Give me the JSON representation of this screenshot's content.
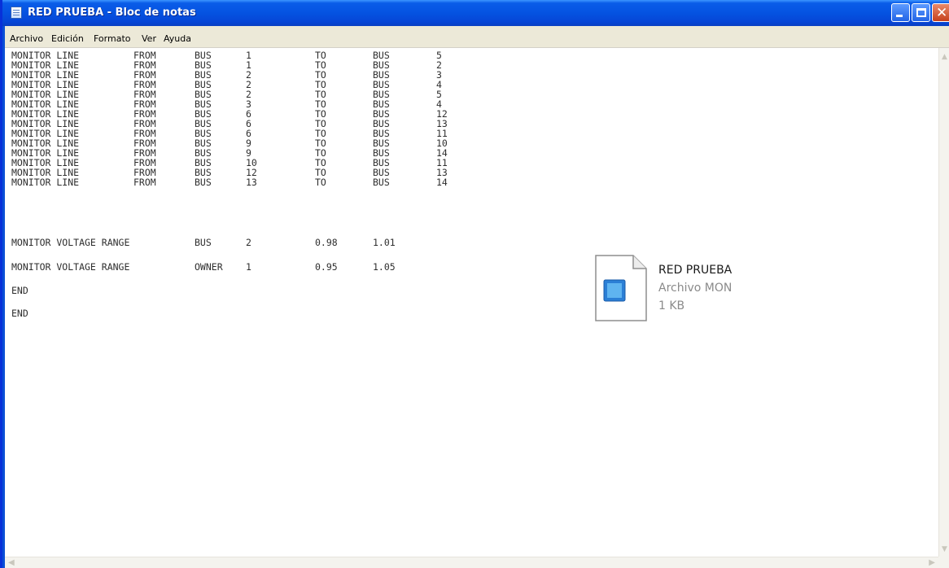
{
  "window": {
    "title": "RED PRUEBA - Bloc de notas",
    "icon": "notepad-icon",
    "controls": {
      "minimize": "minimize-icon",
      "maximize": "maximize-icon",
      "close": "close-icon",
      "close_glyph": "✕"
    }
  },
  "menu": [
    "Archivo",
    "Edición",
    "Formato",
    "Ver",
    "Ayuda"
  ],
  "content": {
    "columns": [
      "MONITOR LINE",
      "FROM",
      "BUS",
      "from_bus",
      "TO",
      "BUS",
      "to_bus"
    ],
    "lines": [
      [
        "MONITOR LINE",
        "FROM",
        "BUS",
        "1",
        "TO",
        "BUS",
        "5"
      ],
      [
        "MONITOR LINE",
        "FROM",
        "BUS",
        "1",
        "TO",
        "BUS",
        "2"
      ],
      [
        "MONITOR LINE",
        "FROM",
        "BUS",
        "2",
        "TO",
        "BUS",
        "3"
      ],
      [
        "MONITOR LINE",
        "FROM",
        "BUS",
        "2",
        "TO",
        "BUS",
        "4"
      ],
      [
        "MONITOR LINE",
        "FROM",
        "BUS",
        "2",
        "TO",
        "BUS",
        "5"
      ],
      [
        "MONITOR LINE",
        "FROM",
        "BUS",
        "3",
        "TO",
        "BUS",
        "4"
      ],
      [
        "MONITOR LINE",
        "FROM",
        "BUS",
        "6",
        "TO",
        "BUS",
        "12"
      ],
      [
        "MONITOR LINE",
        "FROM",
        "BUS",
        "6",
        "TO",
        "BUS",
        "13"
      ],
      [
        "MONITOR LINE",
        "FROM",
        "BUS",
        "6",
        "TO",
        "BUS",
        "11"
      ],
      [
        "MONITOR LINE",
        "FROM",
        "BUS",
        "9",
        "TO",
        "BUS",
        "10"
      ],
      [
        "MONITOR LINE",
        "FROM",
        "BUS",
        "9",
        "TO",
        "BUS",
        "14"
      ],
      [
        "MONITOR LINE",
        "FROM",
        "BUS",
        "10",
        "TO",
        "BUS",
        "11"
      ],
      [
        "MONITOR LINE",
        "FROM",
        "BUS",
        "12",
        "TO",
        "BUS",
        "13"
      ],
      [
        "MONITOR LINE",
        "FROM",
        "BUS",
        "13",
        "TO",
        "BUS",
        "14"
      ]
    ],
    "voltage_bus": [
      "MONITOR VOLTAGE RANGE",
      "BUS",
      "2",
      "0.98",
      "1.01"
    ],
    "voltage_owner": [
      "MONITOR VOLTAGE RANGE",
      "OWNER",
      "1",
      "0.95",
      "1.05"
    ],
    "end1": "END",
    "end2": "END"
  },
  "file_tooltip": {
    "icon": "document-file-icon",
    "name": "RED PRUEBA",
    "type": "Archivo MON",
    "size": "1 KB"
  }
}
